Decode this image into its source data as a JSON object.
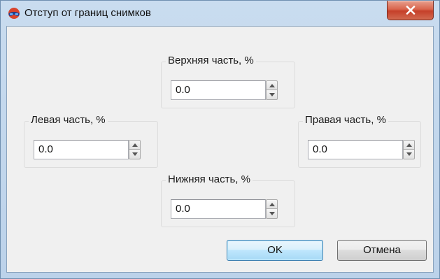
{
  "window": {
    "title": "Отступ от границ снимков",
    "icon": "app-glasses-icon",
    "close_icon": "close-icon"
  },
  "fields": {
    "top": {
      "label": "Верхняя часть, %",
      "value": "0.0"
    },
    "left": {
      "label": "Левая часть, %",
      "value": "0.0"
    },
    "right": {
      "label": "Правая часть, %",
      "value": "0.0"
    },
    "bottom": {
      "label": "Нижняя часть, %",
      "value": "0.0"
    }
  },
  "buttons": {
    "ok": "OK",
    "cancel": "Отмена"
  },
  "colors": {
    "titlebar": "#bcd2ea",
    "client_background": "#f0f0f0",
    "close_button": "#c5402a",
    "default_button_border": "#3c7fb1"
  }
}
